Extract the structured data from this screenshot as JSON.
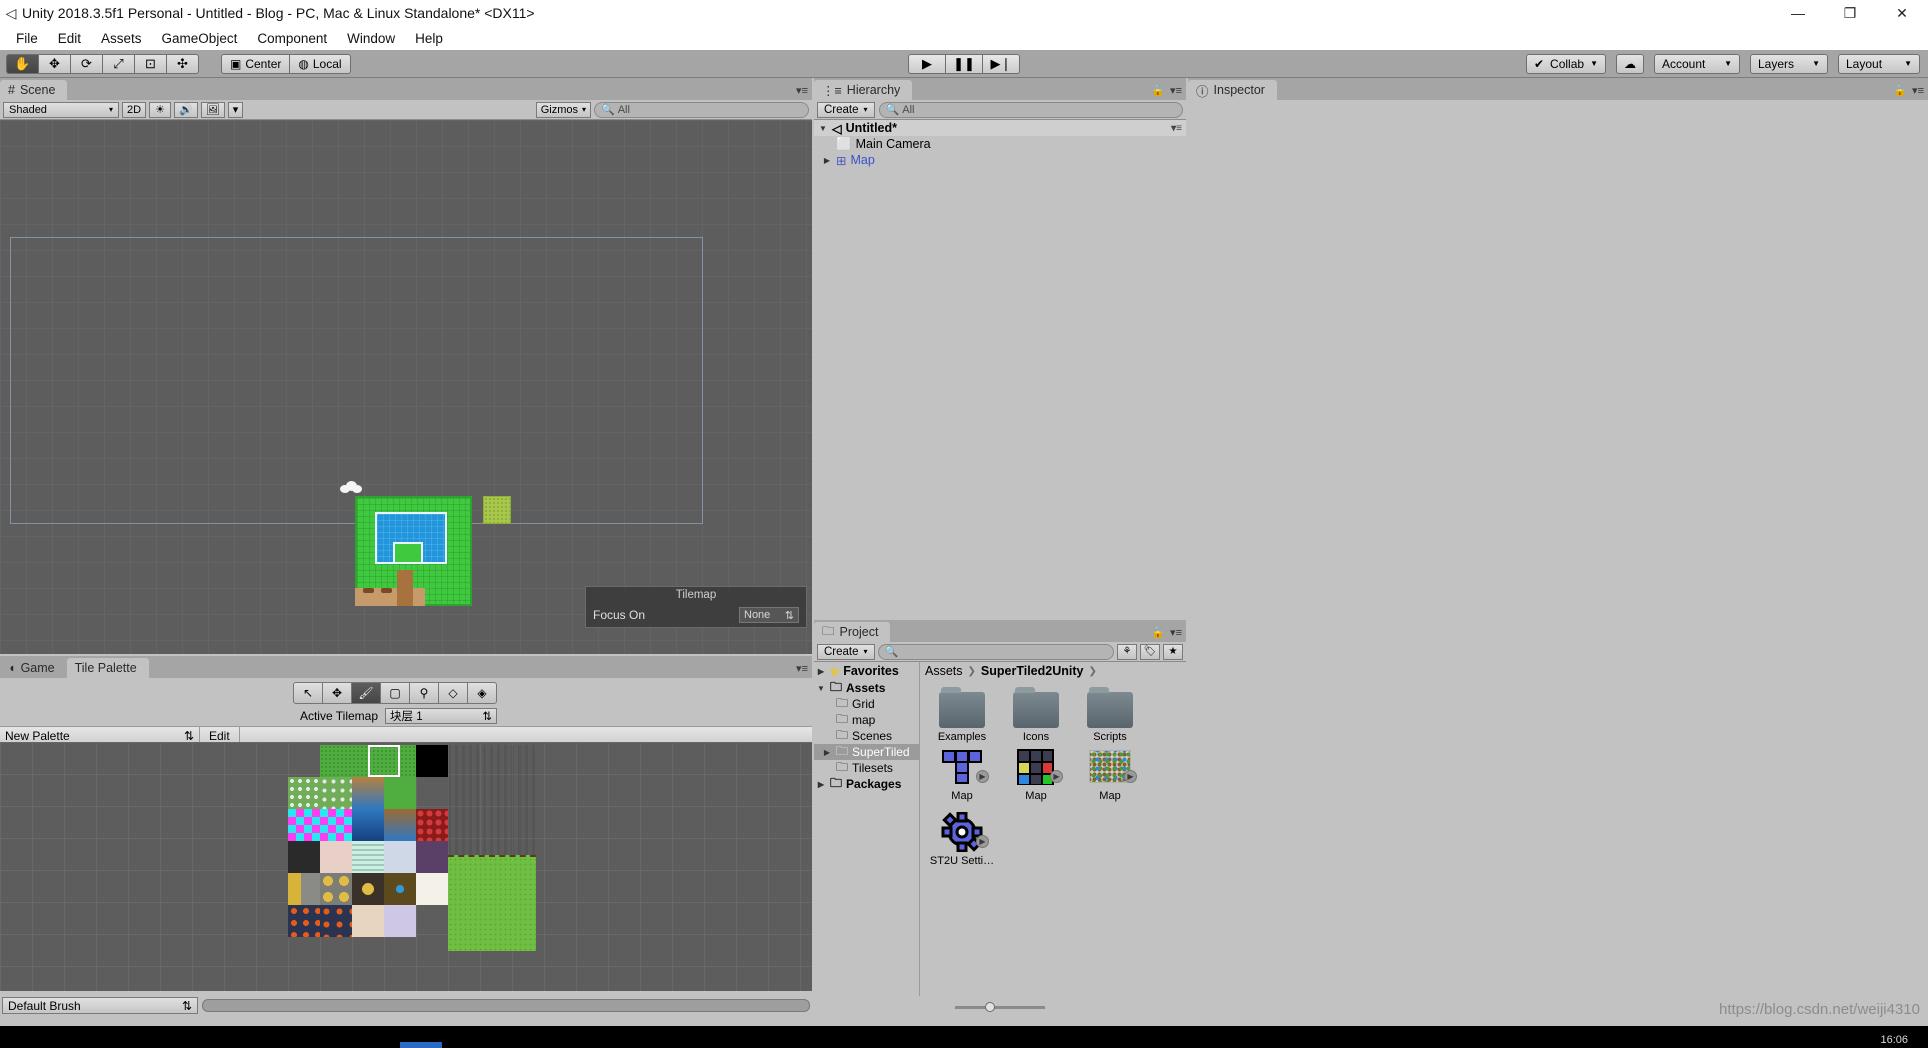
{
  "window": {
    "title": "Unity 2018.3.5f1 Personal - Untitled - Blog - PC, Mac & Linux Standalone* <DX11>",
    "app_icon": "unity-icon",
    "minimize": "—",
    "maximize": "❐",
    "close": "✕"
  },
  "menubar": {
    "items": [
      "File",
      "Edit",
      "Assets",
      "GameObject",
      "Component",
      "Window",
      "Help"
    ]
  },
  "toolbar": {
    "tools": [
      {
        "name": "hand-tool",
        "glyph": "✋",
        "active": true
      },
      {
        "name": "move-tool",
        "glyph": "✥",
        "active": false
      },
      {
        "name": "rotate-tool",
        "glyph": "⟳",
        "active": false
      },
      {
        "name": "scale-tool",
        "glyph": "⤢",
        "active": false
      },
      {
        "name": "rect-tool",
        "glyph": "⊡",
        "active": false
      },
      {
        "name": "transform-tool",
        "glyph": "✣",
        "active": false
      }
    ],
    "pivot": "Center",
    "pivot_icon": "pivot-icon",
    "space": "Local",
    "space_icon": "globe-icon",
    "play": "▶",
    "pause": "❚❚",
    "step": "▶❘",
    "collab": "Collab",
    "collab_icon": "check-circle-icon",
    "cloud_icon": "cloud-icon",
    "account": "Account",
    "layers": "Layers",
    "layout": "Layout"
  },
  "scene": {
    "tab": "Scene",
    "tab_icon": "grid-hash-icon",
    "draw_mode": "Shaded",
    "mode_2d": "2D",
    "lighting_icon": "sun-icon",
    "audio_icon": "speaker-icon",
    "fx_icon": "image-icon",
    "gizmos": "Gizmos",
    "search_placeholder": "All",
    "search_icon": "search-icon",
    "overlay": {
      "title": "Tilemap",
      "focus_label": "Focus On",
      "focus_value": "None"
    }
  },
  "palette": {
    "tabs": [
      {
        "label": "Game",
        "icon": "game-icon",
        "active": false
      },
      {
        "label": "Tile Palette",
        "icon": "",
        "active": true
      }
    ],
    "tools": [
      {
        "name": "select-tool",
        "glyph": "↖",
        "active": false
      },
      {
        "name": "move-tool",
        "glyph": "✥",
        "active": false
      },
      {
        "name": "paint-brush-tool",
        "glyph": "🖌",
        "active": true
      },
      {
        "name": "box-fill-tool",
        "glyph": "▢",
        "active": false
      },
      {
        "name": "picker-tool",
        "glyph": "⚲",
        "active": false
      },
      {
        "name": "eraser-tool",
        "glyph": "◇",
        "active": false
      },
      {
        "name": "fill-tool",
        "glyph": "◈",
        "active": false
      }
    ],
    "active_tilemap_label": "Active Tilemap",
    "active_tilemap_value": "块层 1",
    "palette_name": "New Palette",
    "edit_label": "Edit",
    "brush_name": "Default Brush"
  },
  "hierarchy": {
    "tab": "Hierarchy",
    "tab_icon": "hierarchy-icon",
    "create": "Create",
    "search_placeholder": "All",
    "lock_icon": "lock-icon",
    "menu_icon": "options-icon",
    "scene_name": "Untitled*",
    "scene_icon": "unity-scene-icon",
    "items": [
      {
        "label": "Main Camera",
        "icon": "gameobject-icon",
        "indent": 1,
        "expandable": false
      },
      {
        "label": "Map",
        "icon": "tilemap-icon",
        "indent": 1,
        "expandable": true,
        "prefab": true
      }
    ]
  },
  "inspector": {
    "tab": "Inspector",
    "tab_icon": "info-icon",
    "lock_icon": "lock-icon",
    "menu_icon": "options-icon"
  },
  "project": {
    "tab": "Project",
    "tab_icon": "folder-icon",
    "create": "Create",
    "search_placeholder": "",
    "search_icon": "search-icon",
    "filter_type_icon": "type-filter-icon",
    "filter_label_icon": "label-filter-icon",
    "favorite_icon": "star-icon",
    "favorites": "Favorites",
    "tree": [
      {
        "label": "Assets",
        "indent": 0,
        "expandable": true,
        "expanded": true,
        "bold": true,
        "selected": false
      },
      {
        "label": "Grid",
        "indent": 1,
        "expandable": false,
        "selected": false
      },
      {
        "label": "map",
        "indent": 1,
        "expandable": false,
        "selected": false
      },
      {
        "label": "Scenes",
        "indent": 1,
        "expandable": false,
        "selected": false
      },
      {
        "label": "SuperTiled",
        "indent": 1,
        "expandable": true,
        "selected": true
      },
      {
        "label": "Tilesets",
        "indent": 1,
        "expandable": false,
        "selected": false
      },
      {
        "label": "Packages",
        "indent": 0,
        "expandable": true,
        "bold": true,
        "selected": false
      }
    ],
    "breadcrumb": [
      "Assets",
      "SuperTiled2Unity",
      ""
    ],
    "assets": [
      {
        "label": "Examples",
        "kind": "folder"
      },
      {
        "label": "Icons",
        "kind": "folder"
      },
      {
        "label": "Scripts",
        "kind": "folder"
      },
      {
        "label": "Map",
        "kind": "tilemap-t"
      },
      {
        "label": "Map",
        "kind": "tilemap-grid"
      },
      {
        "label": "Map",
        "kind": "tilemap-photo"
      },
      {
        "label": "ST2U Setti…",
        "kind": "gear"
      }
    ]
  },
  "statusbar": {
    "watermark": "https://blog.csdn.net/weiji4310",
    "clock": "16:06"
  },
  "colors": {
    "chrome": "#c2c2c2",
    "toolbar": "#a5a5a5",
    "viewport": "#5d5d5d",
    "accent_blue": "#4a57c8",
    "grass": "#3ec93e",
    "water": "#2196dd"
  }
}
